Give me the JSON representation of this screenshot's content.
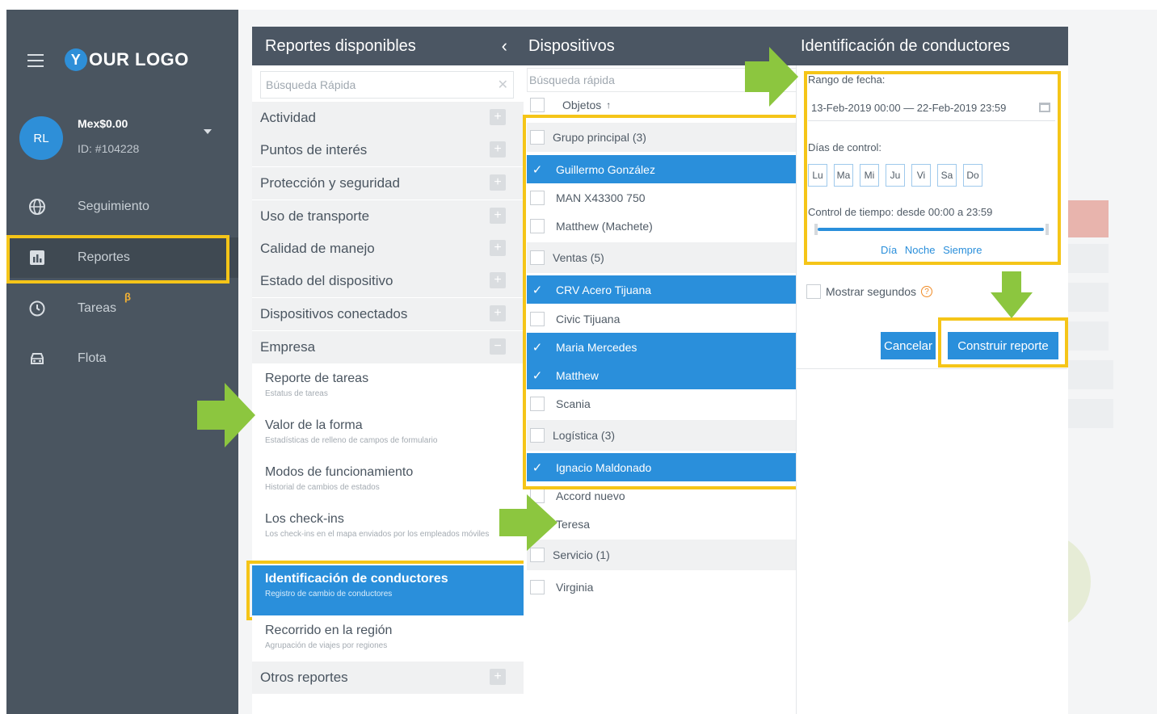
{
  "brand": {
    "logo_text": "OUR LOGO",
    "logo_letter": "Y"
  },
  "user": {
    "initials": "RL",
    "balance": "Mex$0.00",
    "id": "ID: #104228"
  },
  "sidebar": {
    "items": [
      {
        "label": "Seguimiento",
        "icon": "globe-icon"
      },
      {
        "label": "Reportes",
        "icon": "chart-icon"
      },
      {
        "label": "Tareas",
        "icon": "clock-icon",
        "badge": "β"
      },
      {
        "label": "Flota",
        "icon": "car-icon"
      }
    ]
  },
  "reports_panel": {
    "title": "Reportes disponibles",
    "search_placeholder": "Búsqueda Rápida",
    "categories": [
      "Actividad",
      "Puntos de interés",
      "Protección y seguridad",
      "Uso de transporte",
      "Calidad de manejo",
      "Estado del dispositivo",
      "Dispositivos conectados",
      "Empresa"
    ],
    "reports": [
      {
        "title": "Reporte de tareas",
        "subtitle": "Estatus de tareas"
      },
      {
        "title": "Valor de la forma",
        "subtitle": "Estadísticas de relleno de campos de formulario"
      },
      {
        "title": "Modos de funcionamiento",
        "subtitle": "Historial de cambios de estados"
      },
      {
        "title": "Los check-ins",
        "subtitle": "Los check-ins en el mapa enviados por los empleados móviles"
      },
      {
        "title": "Identificación de conductores",
        "subtitle": "Registro de cambio de conductores"
      },
      {
        "title": "Recorrido en la región",
        "subtitle": "Agrupación de viajes por regiones"
      }
    ],
    "other_reports": "Otros reportes"
  },
  "devices_panel": {
    "title": "Dispositivos",
    "search_placeholder": "Búsqueda rápida",
    "objects_header": "Objetos",
    "rows": [
      {
        "label": "Grupo principal (3)",
        "type": "group",
        "selected": false
      },
      {
        "label": "Guillermo González",
        "type": "item",
        "selected": true
      },
      {
        "label": "MAN X43300 750",
        "type": "item",
        "selected": false
      },
      {
        "label": "Matthew (Machete)",
        "type": "item",
        "selected": false
      },
      {
        "label": "Ventas (5)",
        "type": "group",
        "selected": false
      },
      {
        "label": "CRV Acero Tijuana",
        "type": "item",
        "selected": true
      },
      {
        "label": "Civic Tijuana",
        "type": "item",
        "selected": false
      },
      {
        "label": "Maria Mercedes",
        "type": "item",
        "selected": true
      },
      {
        "label": "Matthew",
        "type": "item",
        "selected": true
      },
      {
        "label": "Scania",
        "type": "item",
        "selected": false
      },
      {
        "label": "Logística (3)",
        "type": "group",
        "selected": false
      },
      {
        "label": "Ignacio Maldonado",
        "type": "item",
        "selected": true
      },
      {
        "label": "Accord nuevo",
        "type": "item",
        "selected": false
      },
      {
        "label": "Teresa",
        "type": "item",
        "selected": false
      },
      {
        "label": "Servicio (1)",
        "type": "group",
        "selected": false
      },
      {
        "label": "Virginia",
        "type": "item",
        "selected": false
      }
    ]
  },
  "config_panel": {
    "title": "Identificación de conductores",
    "date_range_label": "Rango de fecha:",
    "date_range_value": "13-Feb-2019 00:00 — 22-Feb-2019 23:59",
    "control_days_label": "Días de control:",
    "days": [
      "Lu",
      "Ma",
      "Mi",
      "Ju",
      "Vi",
      "Sa",
      "Do"
    ],
    "time_control_label": "Control de tiempo: desde 00:00 a 23:59",
    "presets": [
      "Día",
      "Noche",
      "Siempre"
    ],
    "show_seconds_label": "Mostrar segundos",
    "help_glyph": "?",
    "cancel_label": "Cancelar",
    "build_label": "Construir reporte"
  },
  "colors": {
    "accent": "#2a8fdb",
    "sidebar_bg": "#4a5560",
    "header_bg": "#4b5663",
    "highlight": "#f5c518",
    "arrow": "#8cc63f"
  }
}
